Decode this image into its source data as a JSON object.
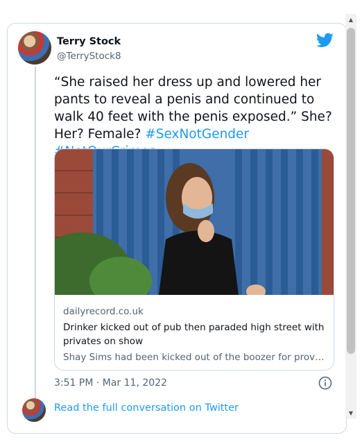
{
  "tweet": {
    "author": {
      "display_name": "Terry Stock",
      "handle": "@TerryStock8"
    },
    "text_main": "“She raised her dress up and lowered her pants to reveal a penis and continued to walk 40 feet with the penis exposed.” She? Her? Female?",
    "hashtags": [
      "#SexNotGender",
      "#NotOurCrimes"
    ],
    "link_card": {
      "domain": "dailyrecord.co.uk",
      "title": "Drinker kicked out of pub then paraded high street with privates on show",
      "description": "Shay Sims had been kicked out of the boozer for provo..."
    },
    "timestamp": "3:51 PM · Mar 11, 2022",
    "read_more": "Read the full conversation on Twitter"
  },
  "colors": {
    "accent": "#1d9bf0",
    "secondary_text": "#536471",
    "border": "#cfd9de"
  },
  "icons": {
    "logo": "twitter-bird-icon",
    "info": "info-icon"
  }
}
